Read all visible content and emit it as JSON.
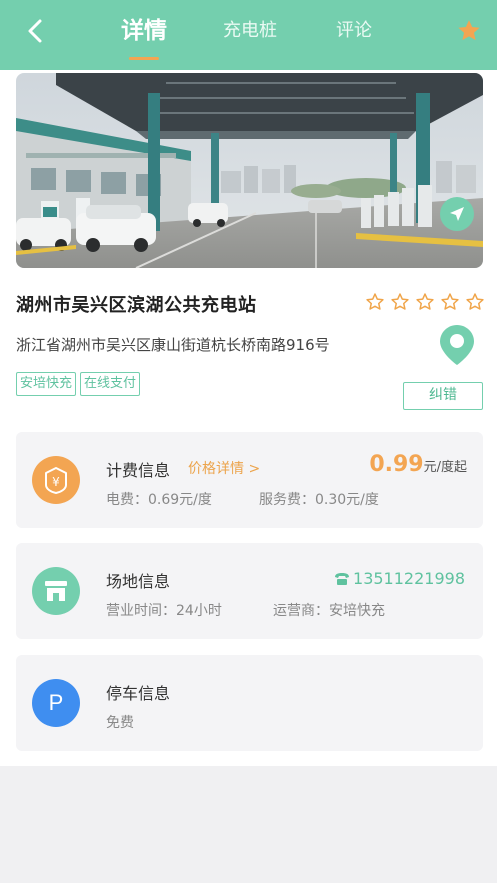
{
  "header": {
    "tabs": [
      {
        "label": "详情",
        "active": true
      },
      {
        "label": "充电桩",
        "active": false
      },
      {
        "label": "评论",
        "active": false
      }
    ],
    "favorite_icon": "star-icon"
  },
  "station": {
    "name": "湖州市吴兴区滨湖公共充电站",
    "rating": 0,
    "rating_max": 5,
    "address": "浙江省湖州市吴兴区康山街道杭长桥南路916号",
    "tags": [
      "安培快充",
      "在线支付"
    ],
    "correct_label": "纠错"
  },
  "billing": {
    "title": "计费信息",
    "detail_link": "价格详情 >",
    "price_value": "0.99",
    "price_unit": "元/度起",
    "electricity_fee": "电费：0.69元/度",
    "service_fee": "服务费：0.30元/度"
  },
  "venue": {
    "title": "场地信息",
    "phone": "13511221998",
    "hours": "营业时间：24小时",
    "operator": "运营商：安培快充"
  },
  "parking": {
    "title": "停车信息",
    "fee": "免费",
    "icon_letter": "P"
  },
  "colors": {
    "brand": "#74cfae",
    "accent": "#f3a552",
    "parking": "#3f8ef0"
  }
}
